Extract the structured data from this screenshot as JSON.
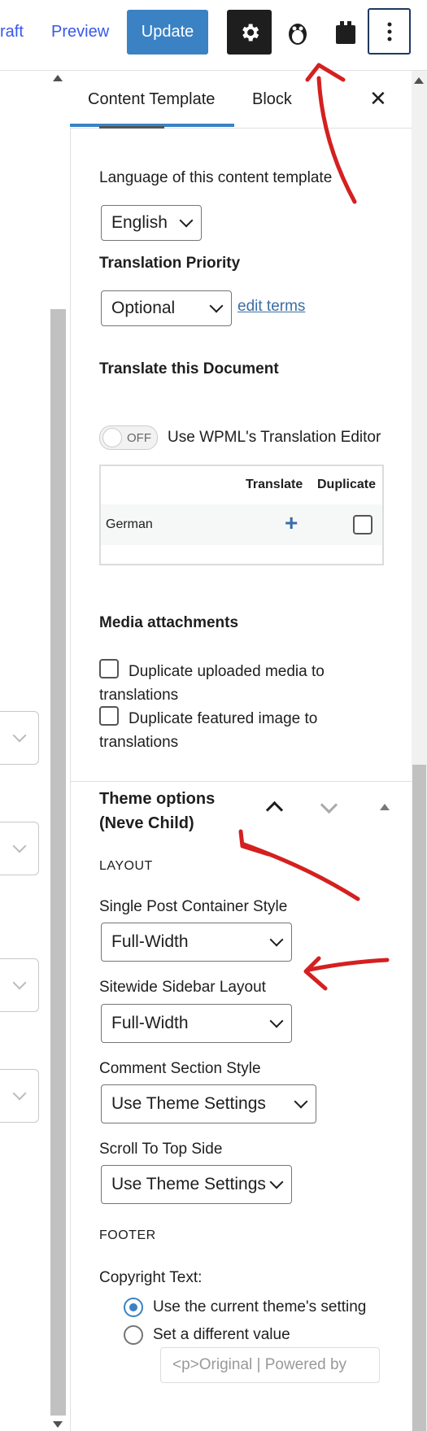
{
  "toolbar": {
    "draft_label": "raft",
    "preview_label": "Preview",
    "update_label": "Update",
    "icons": [
      "gear-icon",
      "penguin-icon",
      "block-plugin-icon",
      "more-vertical-icon"
    ]
  },
  "sidebar": {
    "tabs": [
      {
        "label": "Content Template",
        "active": true
      },
      {
        "label": "Block",
        "active": false
      }
    ],
    "close_label": "✕",
    "language_label": "Language of this content template",
    "language_value": "English",
    "priority_label": "Translation Priority",
    "priority_value": "Optional",
    "edit_terms_label": "edit terms",
    "translate_doc_label": "Translate this Document",
    "toggle_state": "OFF",
    "toggle_label": "Use WPML's Translation Editor",
    "table": {
      "headers": [
        "Translate",
        "Duplicate"
      ],
      "rows": [
        {
          "language": "German",
          "translate_symbol": "+"
        }
      ]
    },
    "media_label": "Media attachments",
    "media_options": [
      "Duplicate uploaded media to translations",
      "Duplicate featured image to translations"
    ],
    "theme_options": {
      "title": "Theme options (Neve Child)",
      "layout_heading": "LAYOUT",
      "fields": [
        {
          "label": "Single Post Container Style",
          "value": "Full-Width"
        },
        {
          "label": "Sitewide Sidebar Layout",
          "value": "Full-Width"
        },
        {
          "label": "Comment Section Style",
          "value": "Use Theme Settings"
        },
        {
          "label": "Scroll To Top Side",
          "value": "Use Theme Settings"
        }
      ],
      "footer_heading": "FOOTER",
      "copyright_label": "Copyright Text:",
      "copyright_options": [
        {
          "label": "Use the current theme's setting",
          "selected": true
        },
        {
          "label": "Set a different value",
          "selected": false
        }
      ],
      "copyright_placeholder": "<p>Original | Powered by"
    }
  },
  "colors": {
    "accent": "#3a82c4",
    "annotation": "#d42020"
  }
}
